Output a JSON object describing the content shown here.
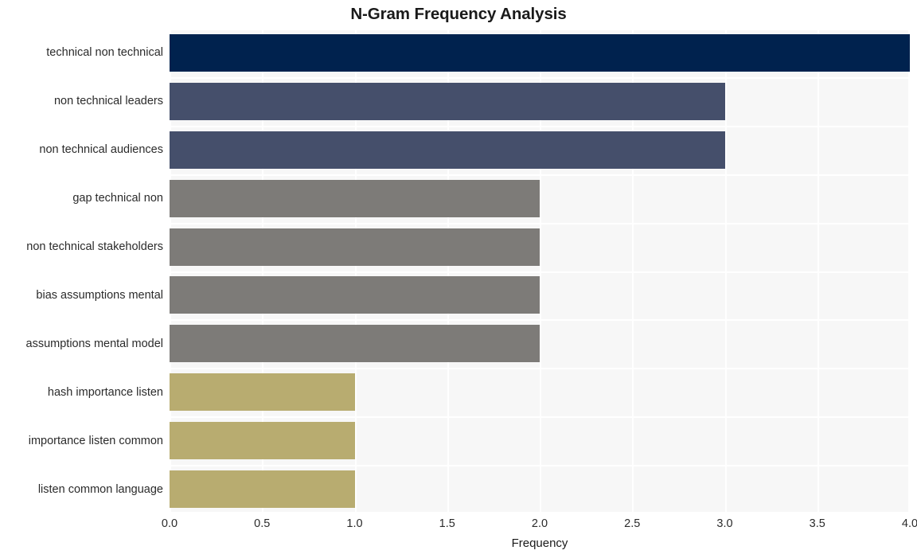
{
  "chart_data": {
    "type": "bar",
    "orientation": "horizontal",
    "title": "N-Gram Frequency Analysis",
    "xlabel": "Frequency",
    "ylabel": "",
    "categories": [
      "technical non technical",
      "non technical leaders",
      "non technical audiences",
      "gap technical non",
      "non technical stakeholders",
      "bias assumptions mental",
      "assumptions mental model",
      "hash importance listen",
      "importance listen common",
      "listen common language"
    ],
    "values": [
      4,
      3,
      3,
      2,
      2,
      2,
      2,
      1,
      1,
      1
    ],
    "bar_colors": [
      "#00224e",
      "#454f6b",
      "#454f6b",
      "#7d7b78",
      "#7d7b78",
      "#7d7b78",
      "#7d7b78",
      "#b8ac70",
      "#b8ac70",
      "#b8ac70"
    ],
    "xlim": [
      0.0,
      4.0
    ],
    "xticks": [
      0.0,
      0.5,
      1.0,
      1.5,
      2.0,
      2.5,
      3.0,
      3.5,
      4.0
    ],
    "xtick_labels": [
      "0.0",
      "0.5",
      "1.0",
      "1.5",
      "2.0",
      "2.5",
      "3.0",
      "3.5",
      "4.0"
    ],
    "grid": true,
    "grid_color": "#ffffff",
    "plot_background": "#f7f7f7",
    "figure_background": "#ffffff",
    "legend": null
  }
}
